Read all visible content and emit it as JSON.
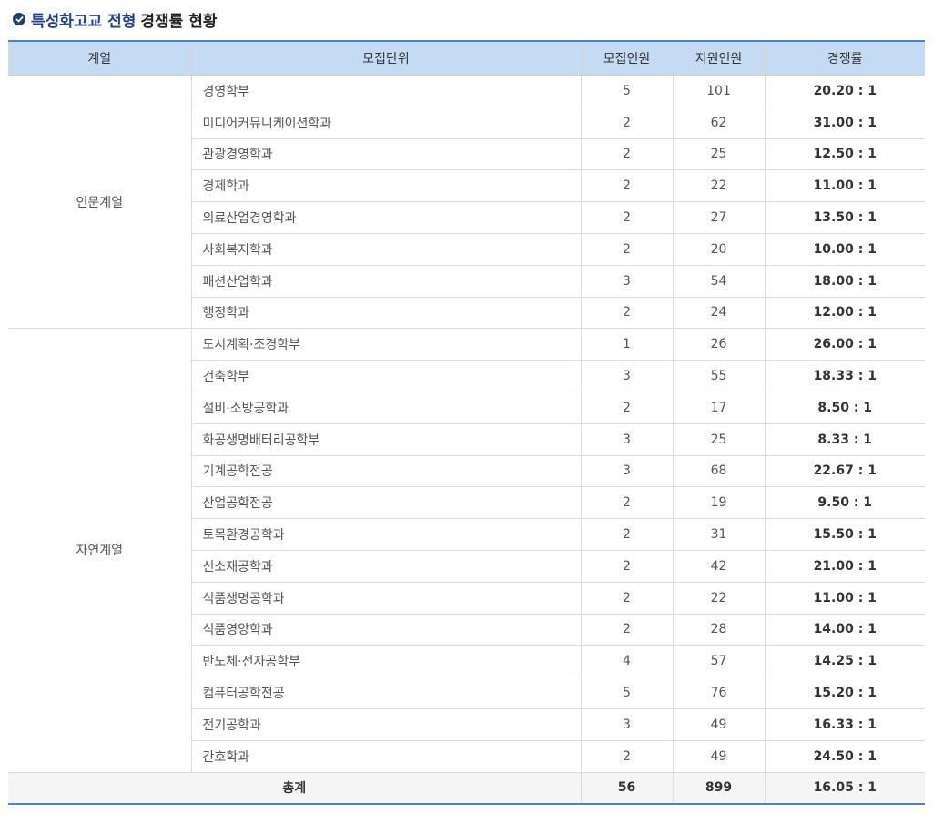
{
  "title": {
    "highlight": "특성화고교 전형",
    "rest": "경쟁률 현황"
  },
  "headers": [
    "계열",
    "모집단위",
    "모집인원",
    "지원인원",
    "경쟁률"
  ],
  "groups": [
    {
      "name": "인문계열",
      "rows": [
        {
          "unit": "경영학부",
          "quota": "5",
          "applicants": "101",
          "ratio": "20.20 : 1"
        },
        {
          "unit": "미디어커뮤니케이션학과",
          "quota": "2",
          "applicants": "62",
          "ratio": "31.00 : 1"
        },
        {
          "unit": "관광경영학과",
          "quota": "2",
          "applicants": "25",
          "ratio": "12.50 : 1"
        },
        {
          "unit": "경제학과",
          "quota": "2",
          "applicants": "22",
          "ratio": "11.00 : 1"
        },
        {
          "unit": "의료산업경영학과",
          "quota": "2",
          "applicants": "27",
          "ratio": "13.50 : 1"
        },
        {
          "unit": "사회복지학과",
          "quota": "2",
          "applicants": "20",
          "ratio": "10.00 : 1"
        },
        {
          "unit": "패션산업학과",
          "quota": "3",
          "applicants": "54",
          "ratio": "18.00 : 1"
        },
        {
          "unit": "행정학과",
          "quota": "2",
          "applicants": "24",
          "ratio": "12.00 : 1"
        }
      ]
    },
    {
      "name": "자연계열",
      "rows": [
        {
          "unit": "도시계획·조경학부",
          "quota": "1",
          "applicants": "26",
          "ratio": "26.00 : 1"
        },
        {
          "unit": "건축학부",
          "quota": "3",
          "applicants": "55",
          "ratio": "18.33 : 1"
        },
        {
          "unit": "설비·소방공학과",
          "quota": "2",
          "applicants": "17",
          "ratio": "8.50 : 1"
        },
        {
          "unit": "화공생명배터리공학부",
          "quota": "3",
          "applicants": "25",
          "ratio": "8.33 : 1"
        },
        {
          "unit": "기계공학전공",
          "quota": "3",
          "applicants": "68",
          "ratio": "22.67 : 1"
        },
        {
          "unit": "산업공학전공",
          "quota": "2",
          "applicants": "19",
          "ratio": "9.50 : 1"
        },
        {
          "unit": "토목환경공학과",
          "quota": "2",
          "applicants": "31",
          "ratio": "15.50 : 1"
        },
        {
          "unit": "신소재공학과",
          "quota": "2",
          "applicants": "42",
          "ratio": "21.00 : 1"
        },
        {
          "unit": "식품생명공학과",
          "quota": "2",
          "applicants": "22",
          "ratio": "11.00 : 1"
        },
        {
          "unit": "식품영양학과",
          "quota": "2",
          "applicants": "28",
          "ratio": "14.00 : 1"
        },
        {
          "unit": "반도체·전자공학부",
          "quota": "4",
          "applicants": "57",
          "ratio": "14.25 : 1"
        },
        {
          "unit": "컴퓨터공학전공",
          "quota": "5",
          "applicants": "76",
          "ratio": "15.20 : 1"
        },
        {
          "unit": "전기공학과",
          "quota": "3",
          "applicants": "49",
          "ratio": "16.33 : 1"
        },
        {
          "unit": "간호학과",
          "quota": "2",
          "applicants": "49",
          "ratio": "24.50 : 1"
        }
      ]
    }
  ],
  "total": {
    "label": "총계",
    "quota": "56",
    "applicants": "899",
    "ratio": "16.05 : 1"
  },
  "colors": {
    "header_bg": "#c5daf3",
    "accent": "#4f7fc7",
    "title_blue": "#24418a"
  },
  "icons": {
    "title": "check-circle-icon"
  }
}
